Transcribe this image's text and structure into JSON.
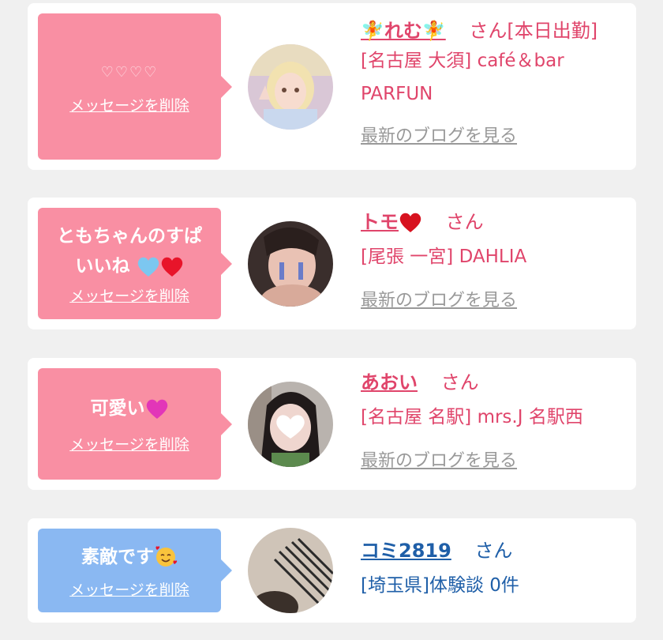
{
  "cards": [
    {
      "message": "♡♡♡♡",
      "delete_label": "メッセージを削除",
      "name": "🧚れむ🧚",
      "san": "さん",
      "status": "[本日出勤]",
      "shop_line1": "[名古屋 大須] café＆bar",
      "shop_line2": "PARFUN",
      "blog_link": "最新のブログを見る"
    },
    {
      "message_line1": "ともちゃんのすぱ",
      "message_line2": "いいね",
      "delete_label": "メッセージを削除",
      "name": "トモ",
      "san": "さん",
      "shop_line1": "[尾張 一宮] DAHLIA",
      "blog_link": "最新のブログを見る"
    },
    {
      "message": "可愛い",
      "delete_label": "メッセージを削除",
      "name": "あおい",
      "san": "さん",
      "shop_line1": "[名古屋 名駅] mrs.J 名駅西",
      "blog_link": "最新のブログを見る"
    },
    {
      "message": "素敵です",
      "delete_label": "メッセージを削除",
      "name": "コミ2819",
      "san": "さん",
      "detail": "[埼玉県]体験談 0件"
    }
  ],
  "colors": {
    "pink_bubble": "#f98fa3",
    "blue_bubble": "#8ab8f2",
    "pink_text": "#e0456b",
    "blue_text": "#1f5fa8",
    "link_gray": "#999999"
  },
  "icons": [
    "heart-light-blue-icon",
    "heart-red-icon",
    "heart-pink-icon",
    "smiling-face-hearts-icon",
    "fairy-icon"
  ]
}
